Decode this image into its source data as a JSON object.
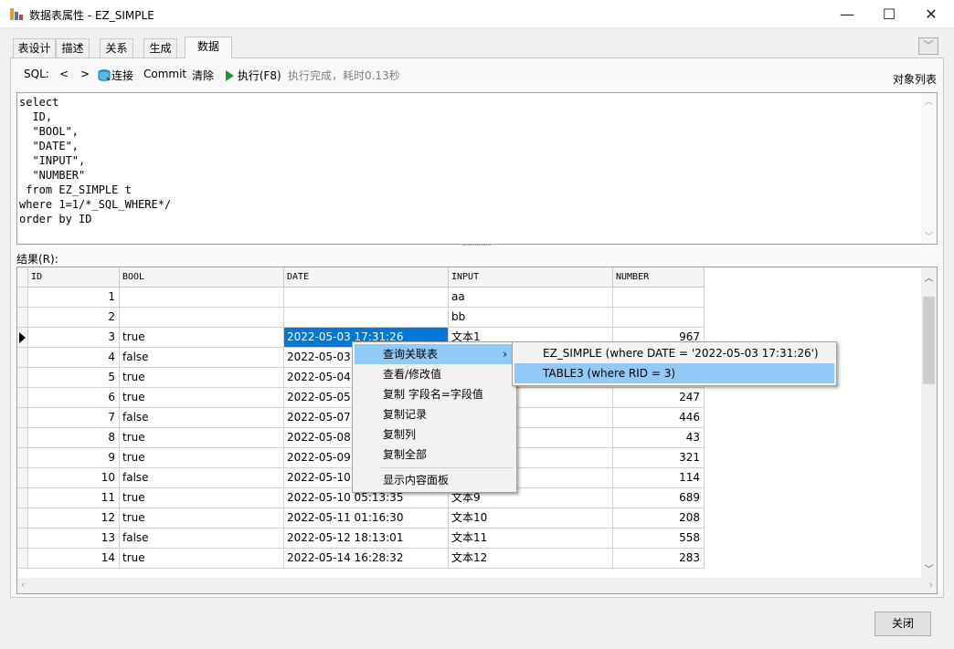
{
  "window": {
    "title": "数据表属性 - EZ_SIMPLE",
    "minimize": "—",
    "maximize": "☐",
    "close": "✕"
  },
  "tabs": [
    {
      "label": "表设计"
    },
    {
      "label": "描述"
    },
    {
      "label": "关系"
    },
    {
      "label": "生成"
    },
    {
      "label": "数据",
      "active": true
    }
  ],
  "toolbar": {
    "sql_label": "SQL:",
    "prev": "<",
    "next": ">",
    "connect": "连接",
    "commit": "Commit",
    "clear": "清除",
    "execute": "执行(F8)",
    "status": "执行完成，耗时0.13秒",
    "object_list": "对象列表"
  },
  "sql": "select\n  ID,\n  \"BOOL\",\n  \"DATE\",\n  \"INPUT\",\n  \"NUMBER\"\n from EZ_SIMPLE t\nwhere 1=1/*_SQL_WHERE*/\norder by ID",
  "results_label": "结果(R):",
  "grid": {
    "columns": [
      "ID",
      "BOOL",
      "DATE",
      "INPUT",
      "NUMBER"
    ],
    "rows": [
      [
        "1",
        "",
        "",
        "aa",
        ""
      ],
      [
        "2",
        "",
        "",
        "bb",
        ""
      ],
      [
        "3",
        "true",
        "2022-05-03 17:31:26",
        "文本1",
        "967"
      ],
      [
        "4",
        "false",
        "2022-05-03",
        "",
        ""
      ],
      [
        "5",
        "true",
        "2022-05-04",
        "",
        ""
      ],
      [
        "6",
        "true",
        "2022-05-05",
        "",
        "247"
      ],
      [
        "7",
        "false",
        "2022-05-07",
        "",
        "446"
      ],
      [
        "8",
        "true",
        "2022-05-08",
        "",
        "43"
      ],
      [
        "9",
        "true",
        "2022-05-09",
        "",
        "321"
      ],
      [
        "10",
        "false",
        "2022-05-10",
        "",
        "114"
      ],
      [
        "11",
        "true",
        "2022-05-10 05:13:35",
        "文本9",
        "689"
      ],
      [
        "12",
        "true",
        "2022-05-11 01:16:30",
        "文本10",
        "208"
      ],
      [
        "13",
        "false",
        "2022-05-12 18:13:01",
        "文本11",
        "558"
      ],
      [
        "14",
        "true",
        "2022-05-14 16:28:32",
        "文本12",
        "283"
      ]
    ]
  },
  "context_menu": {
    "items": [
      "查询关联表",
      "查看/修改值",
      "复制 字段名=字段值",
      "复制记录",
      "复制列",
      "复制全部",
      "显示内容面板"
    ],
    "submenu_arrow": "›",
    "submenu": [
      "EZ_SIMPLE (where DATE = '2022-05-03 17:31:26')",
      "TABLE3 (where RID = 3)"
    ]
  },
  "close_button": "关闭",
  "colors": {
    "selection": "#0078d7",
    "menu_hover": "#91c9f7",
    "execute_icon": "#1a9a2a"
  }
}
